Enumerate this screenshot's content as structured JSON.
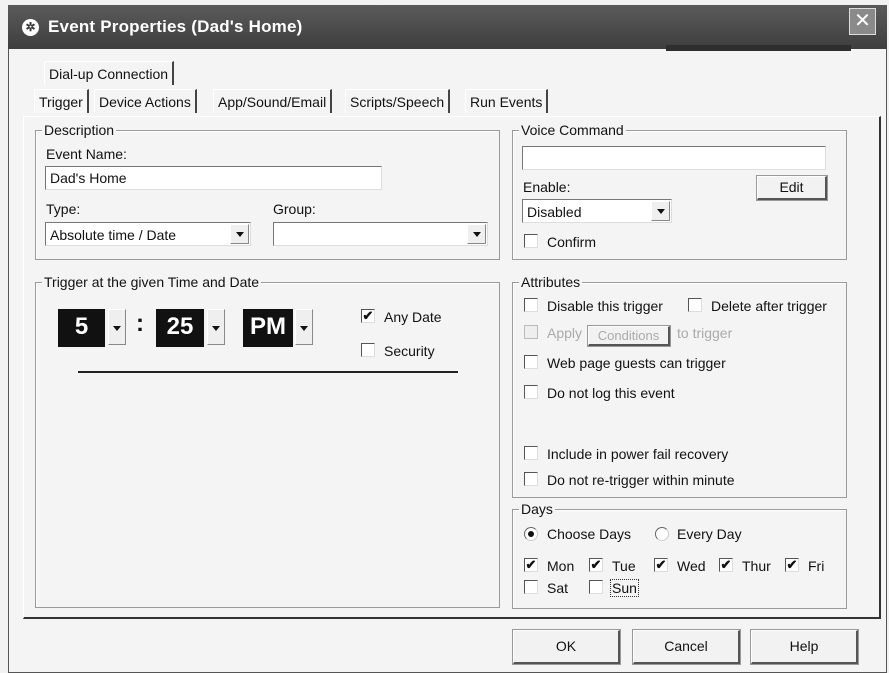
{
  "window": {
    "title": "Event Properties (Dad's Home)",
    "close_glyph": "✕"
  },
  "tabs": {
    "row1": [
      "Dial-up Connection"
    ],
    "row2": [
      "Trigger",
      "Device Actions",
      "App/Sound/Email",
      "Scripts/Speech",
      "Run Events"
    ],
    "active": "Trigger"
  },
  "description": {
    "group_title": "Description",
    "event_name_label": "Event Name:",
    "event_name_value": "Dad's Home",
    "type_label": "Type:",
    "type_value": "Absolute time / Date",
    "group_label": "Group:",
    "group_value": ""
  },
  "trigger_time": {
    "group_title": "Trigger at the given Time and Date",
    "hour": "5",
    "colon": ":",
    "minute": "25",
    "ampm": "PM",
    "any_date_label": "Any Date",
    "any_date_checked": true,
    "security_label": "Security",
    "security_checked": false
  },
  "voice": {
    "group_title": "Voice Command",
    "command_value": "",
    "enable_label": "Enable:",
    "enable_value": "Disabled",
    "edit_label": "Edit",
    "confirm_label": "Confirm",
    "confirm_checked": false
  },
  "attributes": {
    "group_title": "Attributes",
    "disable_label": "Disable this trigger",
    "delete_label": "Delete after trigger",
    "apply_label": "Apply",
    "conditions_label": "Conditions",
    "to_trigger_label": "to trigger",
    "web_guests_label": "Web page guests can trigger",
    "no_log_label": "Do not log this event",
    "power_fail_label": "Include in power fail recovery",
    "no_retrigger_label": "Do not re-trigger within minute"
  },
  "days": {
    "group_title": "Days",
    "choose_days_label": "Choose Days",
    "every_day_label": "Every Day",
    "selected_mode": "Choose Days",
    "items": [
      {
        "label": "Mon",
        "checked": true
      },
      {
        "label": "Tue",
        "checked": true
      },
      {
        "label": "Wed",
        "checked": true
      },
      {
        "label": "Thur",
        "checked": true
      },
      {
        "label": "Fri",
        "checked": true
      },
      {
        "label": "Sat",
        "checked": false
      },
      {
        "label": "Sun",
        "checked": false
      }
    ]
  },
  "footer": {
    "ok_label": "OK",
    "cancel_label": "Cancel",
    "help_label": "Help"
  },
  "icons": {
    "title_icon": "app-gear-icon",
    "check_glyph": "✔"
  }
}
